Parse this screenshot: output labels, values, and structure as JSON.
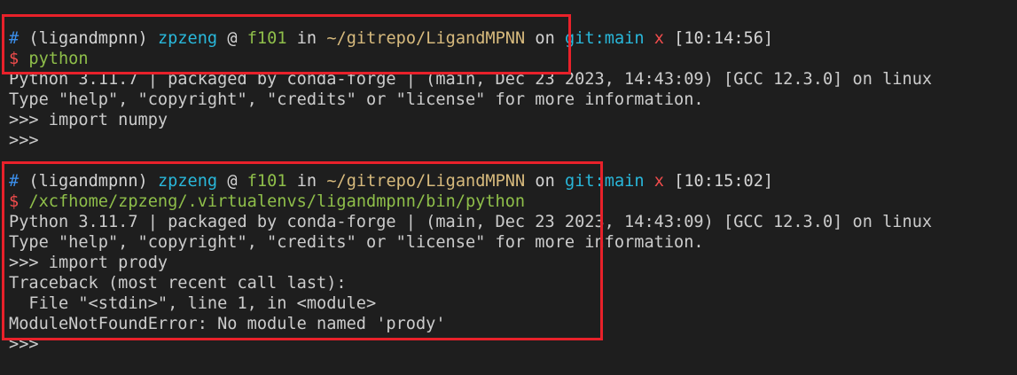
{
  "colors": {
    "background": "#1e1e1e",
    "prompt_hash": "#3b8eea",
    "env_user": "#29b8db",
    "host_path": "#8fbf4a",
    "dollar_x": "#f14c4c",
    "highlight_box": "#e8212a"
  },
  "blocks": [
    {
      "prompt": {
        "hash": "#",
        "env": "(ligandmpnn)",
        "user": "zpzeng",
        "at": "@",
        "host": "f101",
        "in": "in",
        "path": "~/gitrepo/LigandMPNN",
        "on": "on",
        "git": "git:main",
        "dirty": "x",
        "time": "[10:14:56]"
      },
      "command": {
        "dollar": "$",
        "text": "python"
      },
      "output": [
        "Python 3.11.7 | packaged by conda-forge | (main, Dec 23 2023, 14:43:09) [GCC 12.3.0] on linux",
        "Type \"help\", \"copyright\", \"credits\" or \"license\" for more information.",
        ">>> import numpy",
        ">>>"
      ]
    },
    {
      "prompt": {
        "hash": "#",
        "env": "(ligandmpnn)",
        "user": "zpzeng",
        "at": "@",
        "host": "f101",
        "in": "in",
        "path": "~/gitrepo/LigandMPNN",
        "on": "on",
        "git": "git:main",
        "dirty": "x",
        "time": "[10:15:02]"
      },
      "command": {
        "dollar": "$",
        "text": "/xcfhome/zpzeng/.virtualenvs/ligandmpnn/bin/python"
      },
      "output": [
        "Python 3.11.7 | packaged by conda-forge | (main, Dec 23 2023, 14:43:09) [GCC 12.3.0] on linux",
        "Type \"help\", \"copyright\", \"credits\" or \"license\" for more information.",
        ">>> import prody",
        "Traceback (most recent call last):",
        "  File \"<stdin>\", line 1, in <module>",
        "ModuleNotFoundError: No module named 'prody'",
        ">>>"
      ]
    }
  ]
}
